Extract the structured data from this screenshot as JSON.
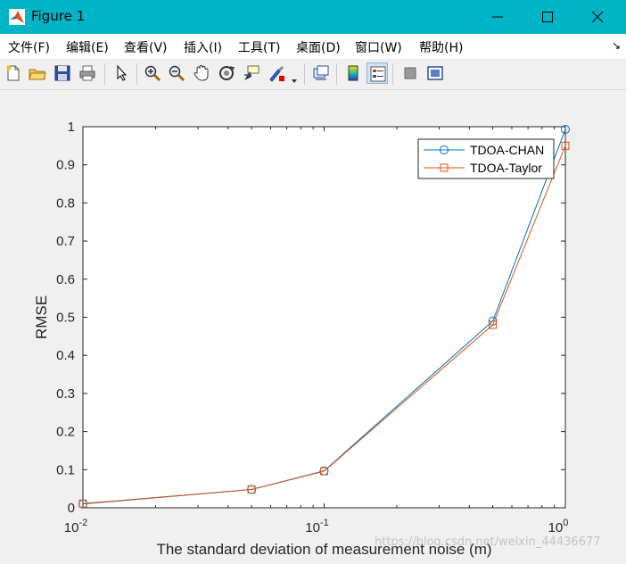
{
  "window": {
    "title": "Figure 1"
  },
  "menu": [
    {
      "label": "文件(F)"
    },
    {
      "label": "编辑(E)"
    },
    {
      "label": "查看(V)"
    },
    {
      "label": "插入(I)"
    },
    {
      "label": "工具(T)"
    },
    {
      "label": "桌面(D)"
    },
    {
      "label": "窗口(W)"
    },
    {
      "label": "帮助(H)"
    }
  ],
  "toolbar_icons": [
    "new-figure-icon",
    "open-file-icon",
    "save-icon",
    "print-icon",
    "pointer-icon",
    "zoom-in-icon",
    "zoom-out-icon",
    "pan-hand-icon",
    "rotate-3d-icon",
    "data-cursor-icon",
    "brush-icon",
    "link-plot-icon",
    "colorbar-icon",
    "legend-icon",
    "hide-plot-tools-icon",
    "show-plot-tools-icon"
  ],
  "watermark": "https://blog.csdn.net/weixin_44436677",
  "chart_data": {
    "type": "line",
    "x": [
      0.01,
      0.05,
      0.1,
      0.5,
      1
    ],
    "xscale": "log",
    "xlim": [
      0.01,
      1
    ],
    "ylim": [
      0,
      1
    ],
    "xticks": [
      {
        "value": 0.01,
        "label": "10^-2"
      },
      {
        "value": 0.1,
        "label": "10^-1"
      },
      {
        "value": 1,
        "label": "10^0"
      }
    ],
    "yticks": [
      "0",
      "0.1",
      "0.2",
      "0.3",
      "0.4",
      "0.5",
      "0.6",
      "0.7",
      "0.8",
      "0.9",
      "1"
    ],
    "xlabel": "The standard deviation of measurement noise (m)",
    "ylabel": "RMSE",
    "legend_position": "top-right",
    "grid": false,
    "series": [
      {
        "name": "TDOA-CHAN",
        "color": "#0072bd",
        "marker": "circle",
        "values": [
          0.01,
          0.048,
          0.097,
          0.49,
          0.993
        ]
      },
      {
        "name": "TDOA-Taylor",
        "color": "#d95319",
        "marker": "square",
        "values": [
          0.011,
          0.048,
          0.096,
          0.48,
          0.95
        ]
      }
    ]
  }
}
